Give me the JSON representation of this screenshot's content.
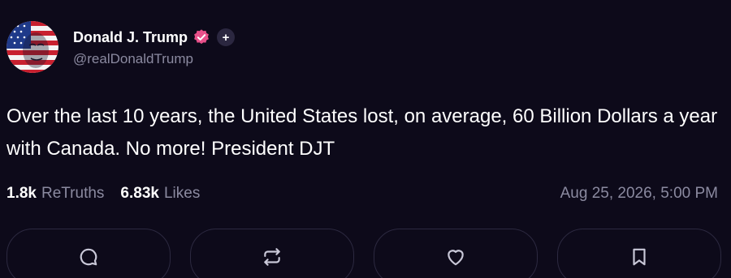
{
  "author": {
    "display_name": "Donald J. Trump",
    "handle": "@realDonaldTrump",
    "avatar_icon": "american-flag-face-avatar",
    "verified_icon": "verified-badge-icon",
    "verified_color": "#e8508a",
    "plus_icon": "plus-icon"
  },
  "post": {
    "text": "Over the last 10 years, the United States lost, on average, 60 Billion Dollars a year with Canada. No more! President DJT",
    "timestamp": "Aug 25, 2026, 5:00 PM"
  },
  "stats": {
    "retruths_count": "1.8k",
    "retruths_label": "ReTruths",
    "likes_count": "6.83k",
    "likes_label": "Likes"
  },
  "actions": [
    {
      "icon": "reply-icon"
    },
    {
      "icon": "retruth-icon"
    },
    {
      "icon": "like-icon"
    },
    {
      "icon": "bookmark-icon"
    }
  ],
  "colors": {
    "background": "#0d0a1a",
    "muted_text": "#8b8aa0",
    "border": "#2c2940"
  }
}
